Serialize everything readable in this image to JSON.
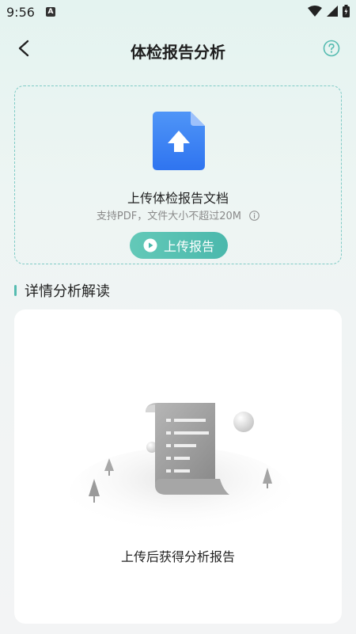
{
  "status": {
    "time": "9:56",
    "notif": "A"
  },
  "header": {
    "title": "体检报告分析"
  },
  "upload": {
    "title": "上传体检报告文档",
    "subtitle": "支持PDF，文件大小不超过20M",
    "button_label": "上传报告"
  },
  "section": {
    "title": "详情分析解读"
  },
  "result": {
    "empty_text": "上传后获得分析报告"
  },
  "colors": {
    "accent": "#56bcb1",
    "file_blue": "#3c84f6",
    "dashed_border": "#7fcbc6"
  }
}
